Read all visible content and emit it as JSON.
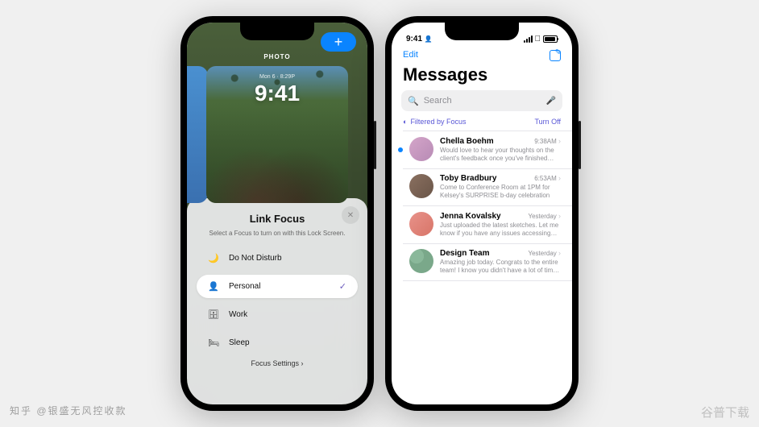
{
  "leftPhone": {
    "header": {
      "addButton": "+",
      "photoLabel": "PHOTO"
    },
    "wallpaper": {
      "date": "Mon 6 · 8:29P",
      "time": "9:41"
    },
    "focusSheet": {
      "title": "Link Focus",
      "subtitle": "Select a Focus to turn on with this Lock Screen.",
      "options": [
        {
          "icon": "🌙",
          "label": "Do Not Disturb",
          "selected": false,
          "iconColor": "#4b3d7a"
        },
        {
          "icon": "👤",
          "label": "Personal",
          "selected": true,
          "iconColor": "#6b5bbd"
        },
        {
          "icon": "🗄",
          "label": "Work",
          "selected": false,
          "iconColor": "#333"
        },
        {
          "icon": "🛏",
          "label": "Sleep",
          "selected": false,
          "iconColor": "#333"
        }
      ],
      "settingsLabel": "Focus Settings ›"
    }
  },
  "rightPhone": {
    "statusBar": {
      "time": "9:41",
      "focusIcon": "👤"
    },
    "nav": {
      "edit": "Edit"
    },
    "title": "Messages",
    "search": {
      "placeholder": "Search"
    },
    "filter": {
      "label": "Filtered by Focus",
      "turnOff": "Turn Off"
    },
    "threads": [
      {
        "name": "Chella Boehm",
        "time": "9:38AM",
        "preview": "Would love to hear your thoughts on the client's feedback once you've finished th…",
        "unread": true
      },
      {
        "name": "Toby Bradbury",
        "time": "6:53AM",
        "preview": "Come to Conference Room at 1PM for Kelsey's SURPRISE b-day celebration",
        "unread": false
      },
      {
        "name": "Jenna Kovalsky",
        "time": "Yesterday",
        "preview": "Just uploaded the latest sketches. Let me know if you have any issues accessing…",
        "unread": false
      },
      {
        "name": "Design Team",
        "time": "Yesterday",
        "preview": "Amazing job today. Congrats to the entire team! I know you didn't have a lot of tim…",
        "unread": false
      }
    ]
  },
  "watermarks": {
    "left": "知乎 @银盛无风控收款",
    "right": "谷普下载"
  }
}
